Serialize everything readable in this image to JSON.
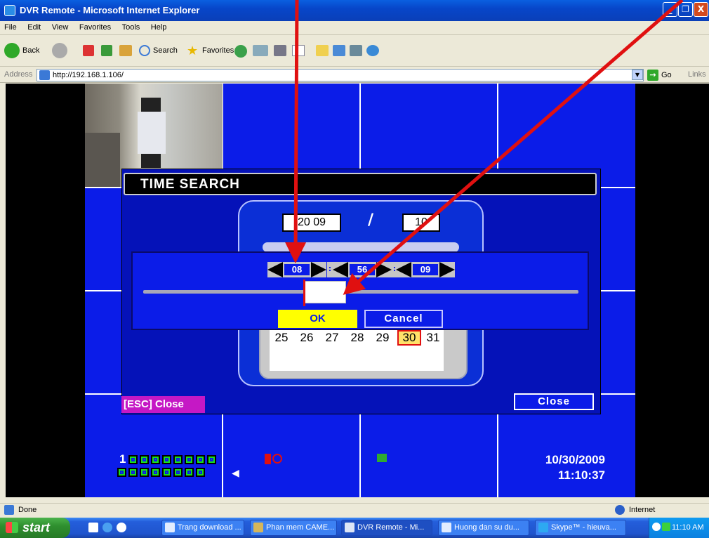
{
  "window": {
    "title": "DVR Remote - Microsoft Internet Explorer",
    "buttons": [
      "_",
      "❐",
      "X"
    ]
  },
  "menu": [
    "File",
    "Edit",
    "View",
    "Favorites",
    "Tools",
    "Help"
  ],
  "toolbar": {
    "back": "Back",
    "search": "Search",
    "favorites": "Favorites"
  },
  "address": {
    "label": "Address",
    "url": "http://192.168.1.106/",
    "go": "Go",
    "links": "Links"
  },
  "dialog": {
    "title": "TIME SEARCH",
    "year": "20 09",
    "slash": "/",
    "month": "10",
    "calendar_days": [
      "25",
      "26",
      "27",
      "28",
      "29",
      "30",
      "31"
    ],
    "selected_day": "30",
    "time": {
      "hour": "08",
      "minute": "56",
      "second": "09",
      "sep": ":"
    },
    "ok": "OK",
    "cancel": "Cancel",
    "esc_close": "[ESC] Close",
    "close": "Close"
  },
  "overlay": {
    "channel_number": "1",
    "date": "10/30/2009",
    "time": "11:10:37"
  },
  "status": {
    "text": "Done",
    "zone": "Internet"
  },
  "taskbar": {
    "start": "start",
    "tasks": [
      {
        "label": "Trang download ..."
      },
      {
        "label": "Phan mem CAME..."
      },
      {
        "label": "DVR Remote - Mi..."
      },
      {
        "label": "Huong dan su du..."
      },
      {
        "label": "Skype™ - hieuva..."
      }
    ],
    "clock": "11:10 AM"
  },
  "colors": {
    "dvr_blue": "#0b1ce8",
    "ok_yellow": "#ffff00",
    "esc_magenta": "#c518c5",
    "annotation_red": "#e01010"
  }
}
